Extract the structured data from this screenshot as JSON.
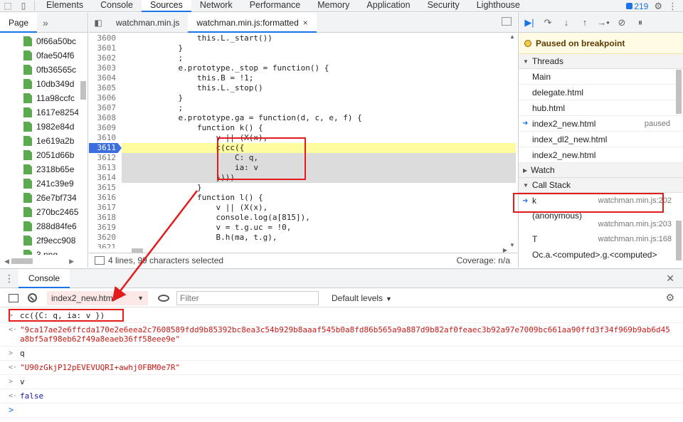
{
  "devtools": {
    "tabs": [
      "Elements",
      "Console",
      "Sources",
      "Network",
      "Performance",
      "Memory",
      "Application",
      "Security",
      "Lighthouse"
    ],
    "active_tab": "Sources",
    "issues_count": "219"
  },
  "navigator": {
    "tab": "Page",
    "more": "»",
    "files": [
      "0f66a50bc",
      "0fae504f6",
      "0fb36565c",
      "10db349d",
      "11a98ccfc",
      "1617e8254",
      "1982e84d",
      "1e619a2b",
      "2051d66b",
      "2318b65e",
      "241c39e9",
      "26e7bf734",
      "270bc2465",
      "288d84fe6",
      "2f9ecc908",
      "3.png"
    ]
  },
  "editor": {
    "tabs": [
      {
        "label": "watchman.min.js",
        "active": false
      },
      {
        "label": "watchman.min.js:formatted",
        "active": true,
        "close": "×"
      }
    ],
    "lines": [
      {
        "num": "3600",
        "text": "                this.L._start())"
      },
      {
        "num": "3601",
        "text": "            }"
      },
      {
        "num": "3602",
        "text": "            ;"
      },
      {
        "num": "3603",
        "text": "            e.prototype._stop = function() {"
      },
      {
        "num": "3604",
        "text": "                this.B = !1;"
      },
      {
        "num": "3605",
        "text": "                this.L._stop()"
      },
      {
        "num": "3606",
        "text": "            }"
      },
      {
        "num": "3607",
        "text": "            ;"
      },
      {
        "num": "3608",
        "text": "            e.prototype.ga = function(d, c, e, f) {"
      },
      {
        "num": "3609",
        "text": "                function k() {"
      },
      {
        "num": "3610",
        "text": "                    v || (X(x),"
      },
      {
        "num": "3611",
        "text": "                    c(cc({"
      },
      {
        "num": "3612",
        "text": "                        C: q,"
      },
      {
        "num": "3613",
        "text": "                        ia: v"
      },
      {
        "num": "3614",
        "text": "                    })))"
      },
      {
        "num": "3615",
        "text": "                }"
      },
      {
        "num": "3616",
        "text": "                function l() {"
      },
      {
        "num": "3617",
        "text": "                    v || (X(x),"
      },
      {
        "num": "3618",
        "text": "                    console.log(a[815]),"
      },
      {
        "num": "3619",
        "text": "                    v = t.g.uc = !0,"
      },
      {
        "num": "3620",
        "text": "                    B.h(ma, t.g),"
      },
      {
        "num": "3621",
        "text": ""
      }
    ],
    "status_text": "4 lines, 99 characters selected",
    "coverage": "Coverage: n/a"
  },
  "debugger": {
    "paused_msg": "Paused on breakpoint",
    "threads_title": "Threads",
    "threads": [
      {
        "name": "Main",
        "status": ""
      },
      {
        "name": "delegate.html",
        "status": ""
      },
      {
        "name": "hub.html",
        "status": ""
      },
      {
        "name": "index2_new.html",
        "status": "paused"
      },
      {
        "name": "index_dl2_new.html",
        "status": ""
      },
      {
        "name": "index2_new.html",
        "status": ""
      }
    ],
    "watch_title": "Watch",
    "callstack_title": "Call Stack",
    "callstack": [
      {
        "fn": "k",
        "loc": "watchman.min.js:202"
      },
      {
        "fn": "(anonymous)",
        "loc": "watchman.min.js:203"
      },
      {
        "fn": "T",
        "loc": "watchman.min.js:168"
      },
      {
        "fn": "Oc.a.<computed>.g.<computed>",
        "loc": ""
      }
    ]
  },
  "console": {
    "tab": "Console",
    "context": "index2_new.html",
    "filter_placeholder": "Filter",
    "levels": "Default levels",
    "messages": [
      {
        "type": "in",
        "prefix": ">",
        "text": "cc({C: q, ia: v })"
      },
      {
        "type": "str",
        "prefix": "<·",
        "text": "\"9ca17ae2e6ffcda170e2e6eea2c7608589fdd9b85392bc8ea3c54b929b8aaaf545b0a8fd86b565a9a887d9b82af0feaec3b92a97e7009bc661aa90ffd3f34f969b9ab6d45a8bf5af98eb62f49a8eaeb36ff58eee9e\""
      },
      {
        "type": "in",
        "prefix": ">",
        "text": "q"
      },
      {
        "type": "str",
        "prefix": "<·",
        "text": "\"U90zGkjP12pEVEVUQRI+awhj0FBM0e7R\""
      },
      {
        "type": "in",
        "prefix": ">",
        "text": "v"
      },
      {
        "type": "bool",
        "prefix": "<·",
        "text": "false"
      },
      {
        "type": "prompt",
        "prefix": ">",
        "text": ""
      }
    ]
  },
  "colors": {
    "accent": "#1a73e8",
    "annotation": "#e41b1b",
    "exec_line": "#fffca0",
    "selection": "#dcdcdc"
  }
}
